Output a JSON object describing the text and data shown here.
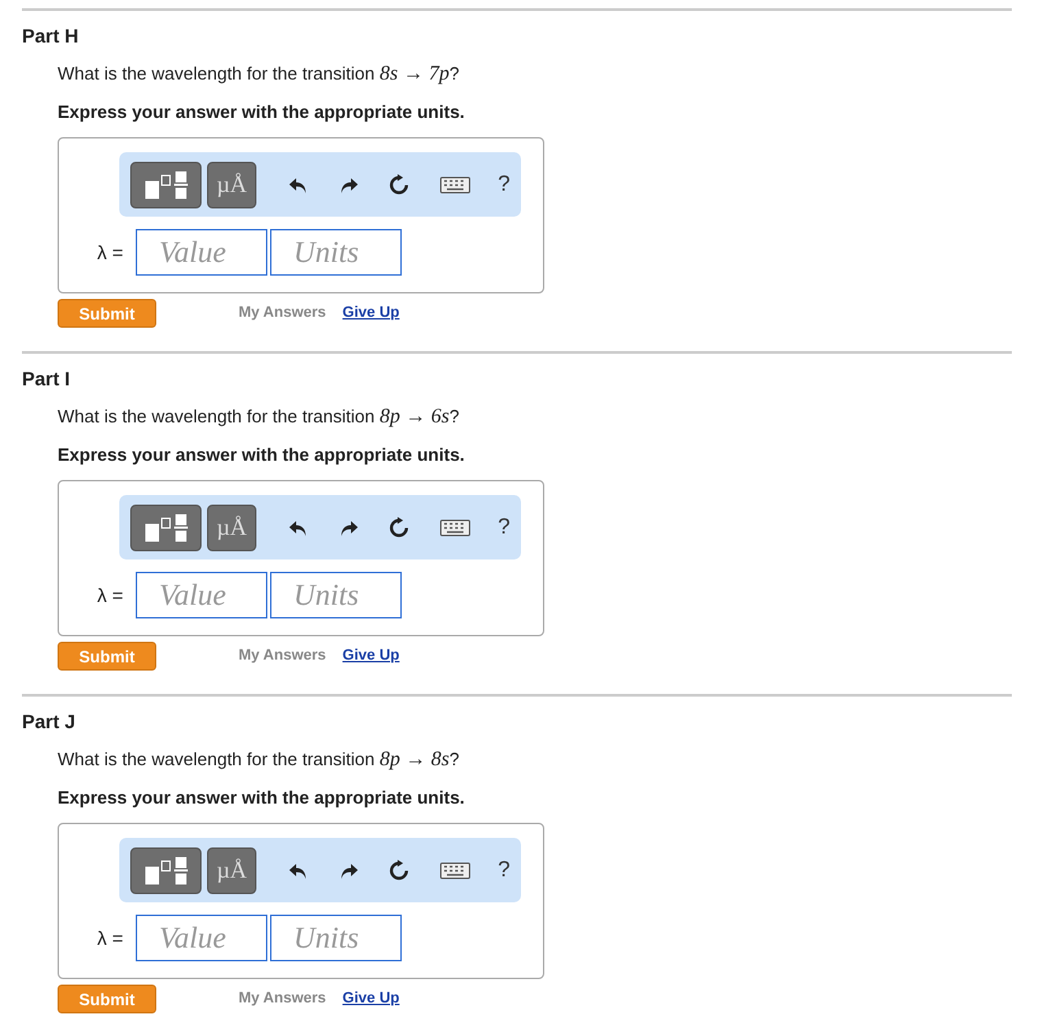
{
  "parts": [
    {
      "title": "Part H",
      "question": {
        "text": "What is the wavelength for the transition ",
        "math": "8s → 7p",
        "end": "?"
      },
      "instruction": "Express your answer with the appropriate units.",
      "toolbar": {
        "units_button": "µÅ",
        "help": "?"
      },
      "label": "λ =",
      "value": {
        "placeholder": "Value"
      },
      "units": {
        "placeholder": "Units"
      },
      "submit": "Submit",
      "my_answers": "My Answers",
      "give_up": "Give Up"
    },
    {
      "title": "Part I",
      "question": {
        "text": "What is the wavelength for the transition ",
        "math": "8p → 6s",
        "end": "?"
      },
      "instruction": "Express your answer with the appropriate units.",
      "toolbar": {
        "units_button": "µÅ",
        "help": "?"
      },
      "label": "λ =",
      "value": {
        "placeholder": "Value"
      },
      "units": {
        "placeholder": "Units"
      },
      "submit": "Submit",
      "my_answers": "My Answers",
      "give_up": "Give Up"
    },
    {
      "title": "Part J",
      "question": {
        "text": "What is the wavelength for the transition ",
        "math": "8p → 8s",
        "end": "?"
      },
      "instruction": "Express your answer with the appropriate units.",
      "toolbar": {
        "units_button": "µÅ",
        "help": "?"
      },
      "label": "λ =",
      "value": {
        "placeholder": "Value"
      },
      "units": {
        "placeholder": "Units"
      },
      "submit": "Submit",
      "my_answers": "My Answers",
      "give_up": "Give Up"
    }
  ]
}
